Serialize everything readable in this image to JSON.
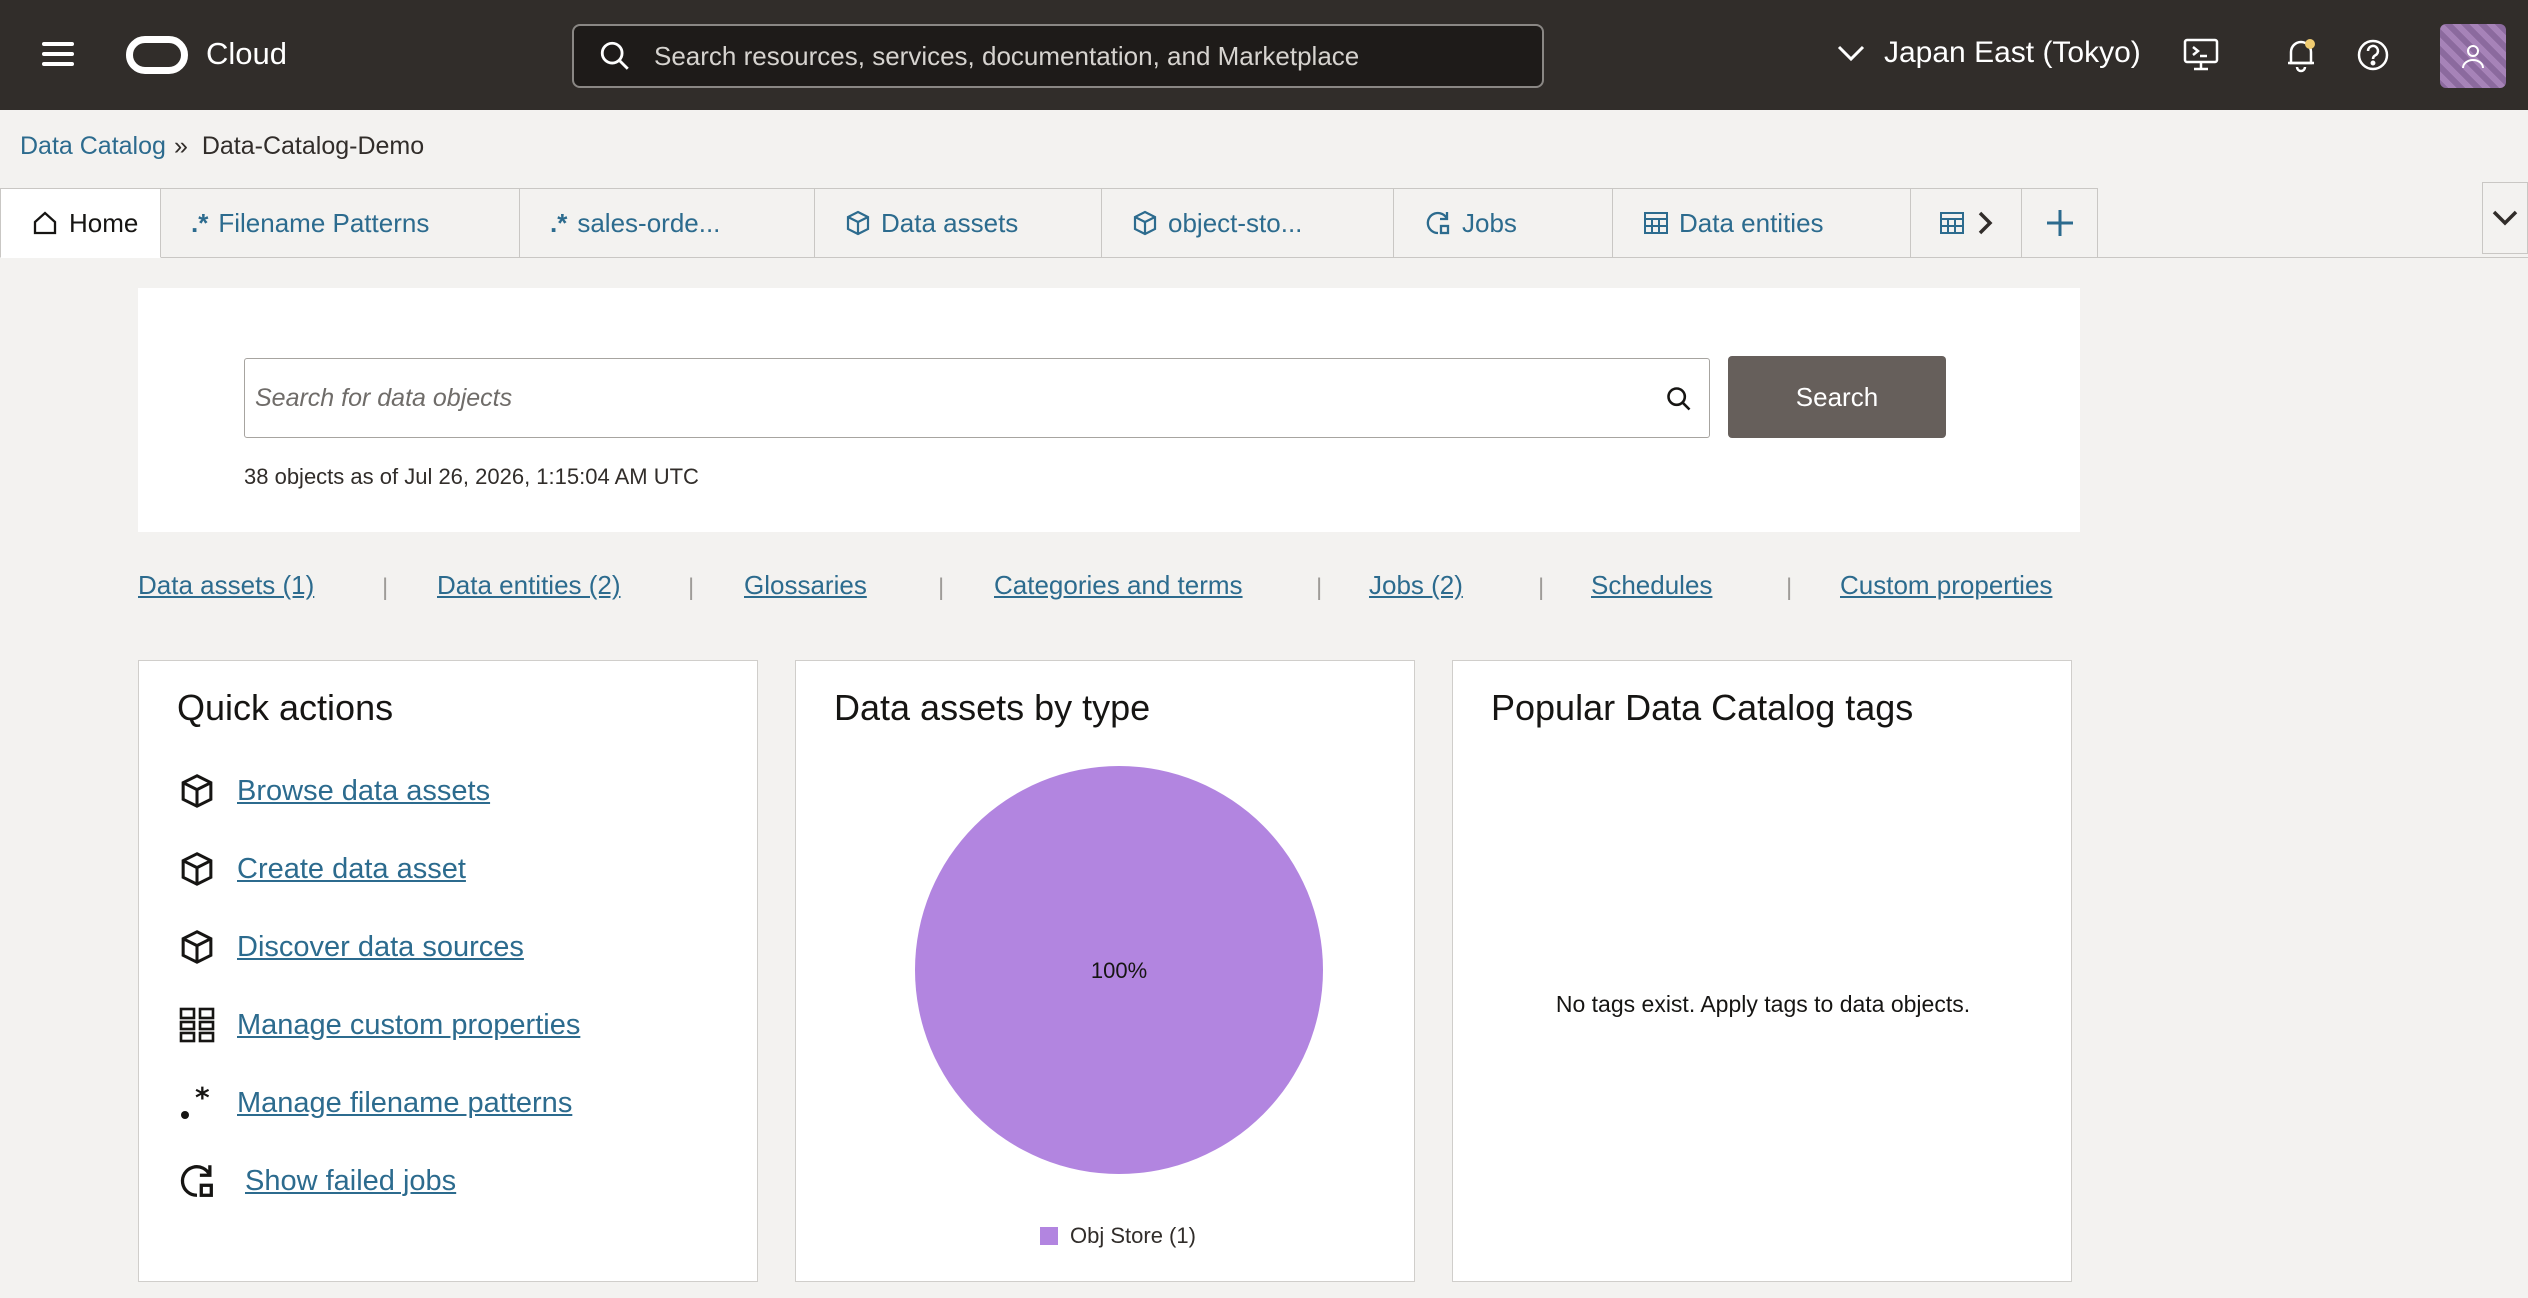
{
  "header": {
    "brand": "Cloud",
    "search_placeholder": "Search resources, services, documentation, and Marketplace",
    "region": "Japan East (Tokyo)"
  },
  "breadcrumb": {
    "parent": "Data Catalog",
    "separator": "»",
    "current": "Data-Catalog-Demo"
  },
  "tabs": [
    {
      "label": "Home",
      "icon": "home-icon",
      "active": true
    },
    {
      "label": "Filename Patterns",
      "icon": "pattern-icon"
    },
    {
      "label": "sales-orde...",
      "icon": "pattern-icon"
    },
    {
      "label": "Data assets",
      "icon": "cube-icon"
    },
    {
      "label": "object-sto...",
      "icon": "cube-icon"
    },
    {
      "label": "Jobs",
      "icon": "jobs-icon"
    },
    {
      "label": "Data entities",
      "icon": "table-icon"
    }
  ],
  "object_search": {
    "placeholder": "Search for data objects",
    "button": "Search",
    "count_text": "38 objects as of Jul 26, 2026, 1:15:04 AM UTC"
  },
  "quick_links": [
    "Data assets (1)",
    "Data entities (2)",
    "Glossaries",
    "Categories and terms",
    "Jobs (2)",
    "Schedules",
    "Custom properties"
  ],
  "quick_actions": {
    "title": "Quick actions",
    "items": [
      {
        "label": "Browse data assets",
        "icon": "cube-icon"
      },
      {
        "label": "Create data asset",
        "icon": "cube-icon"
      },
      {
        "label": "Discover data sources",
        "icon": "cube-icon"
      },
      {
        "label": "Manage custom properties",
        "icon": "grid-icon"
      },
      {
        "label": "Manage filename patterns",
        "icon": "pattern-icon"
      },
      {
        "label": "Show failed jobs",
        "icon": "jobs-icon"
      }
    ]
  },
  "assets_card": {
    "title": "Data assets by type"
  },
  "tags_card": {
    "title": "Popular Data Catalog tags",
    "empty_text": "No tags exist. Apply tags to data objects."
  },
  "colors": {
    "header_bg": "#312d2a",
    "link": "#2c6b8e",
    "pie": "#b285e0",
    "search_button": "#665f5b"
  },
  "chart_data": {
    "type": "pie",
    "categories": [
      "Obj Store (1)"
    ],
    "values": [
      100
    ],
    "data_labels": [
      "100%"
    ],
    "legend": "bottom"
  }
}
